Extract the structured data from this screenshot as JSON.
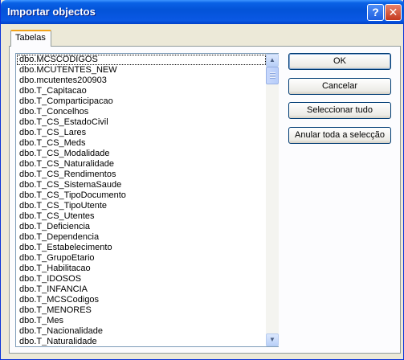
{
  "window": {
    "title": "Importar objectos"
  },
  "titlebar_buttons": {
    "help": "?",
    "close": "✕"
  },
  "tabs": [
    {
      "label": "Tabelas",
      "selected": true
    }
  ],
  "list": {
    "items": [
      "dbo.MCSCODIGOS",
      "dbo.MCUTENTES_NEW",
      "dbo.mcutentes200903",
      "dbo.T_Capitacao",
      "dbo.T_Comparticipacao",
      "dbo.T_Concelhos",
      "dbo.T_CS_EstadoCivil",
      "dbo.T_CS_Lares",
      "dbo.T_CS_Meds",
      "dbo.T_CS_Modalidade",
      "dbo.T_CS_Naturalidade",
      "dbo.T_CS_Rendimentos",
      "dbo.T_CS_SistemaSaude",
      "dbo.T_CS_TipoDocumento",
      "dbo.T_CS_TipoUtente",
      "dbo.T_CS_Utentes",
      "dbo.T_Deficiencia",
      "dbo.T_Dependencia",
      "dbo.T_Estabelecimento",
      "dbo.T_GrupoEtario",
      "dbo.T_Habilitacao",
      "dbo.T_IDOSOS",
      "dbo.T_INFANCIA",
      "dbo.T_MCSCodigos",
      "dbo.T_MENORES",
      "dbo.T_Mes",
      "dbo.T_Nacionalidade",
      "dbo.T_Naturalidade"
    ]
  },
  "buttons": {
    "ok": "OK",
    "cancel": "Cancelar",
    "select_all": "Seleccionar tudo",
    "deselect_all": "Anular toda a selecção"
  },
  "icons": {
    "scroll_up": "scroll-up-arrow-icon",
    "scroll_down": "scroll-down-arrow-icon"
  },
  "colors": {
    "titlebar": "#0a58e4",
    "dialog_bg": "#ece9d8",
    "tab_highlight": "#f2a31a"
  }
}
